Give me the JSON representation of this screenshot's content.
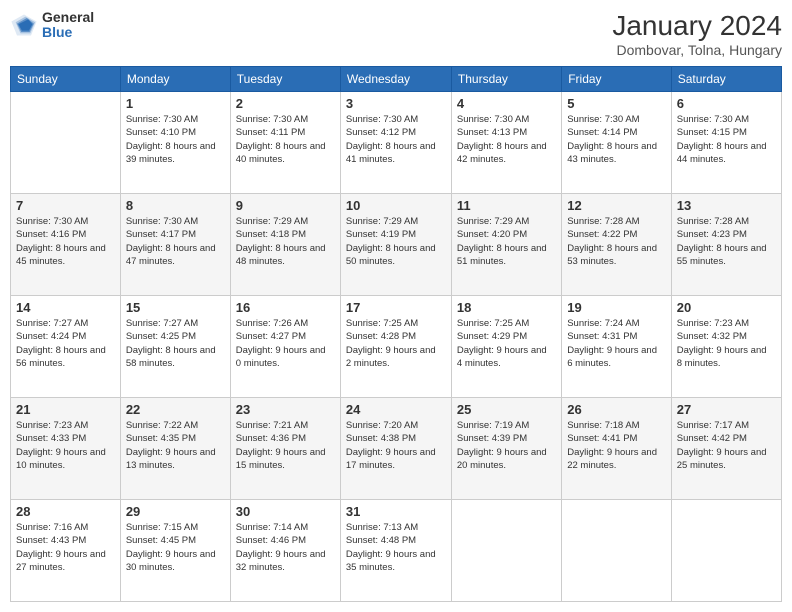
{
  "header": {
    "logo_general": "General",
    "logo_blue": "Blue",
    "month_title": "January 2024",
    "location": "Dombovar, Tolna, Hungary"
  },
  "weekdays": [
    "Sunday",
    "Monday",
    "Tuesday",
    "Wednesday",
    "Thursday",
    "Friday",
    "Saturday"
  ],
  "weeks": [
    [
      {
        "day": "",
        "sunrise": "",
        "sunset": "",
        "daylight": ""
      },
      {
        "day": "1",
        "sunrise": "Sunrise: 7:30 AM",
        "sunset": "Sunset: 4:10 PM",
        "daylight": "Daylight: 8 hours and 39 minutes."
      },
      {
        "day": "2",
        "sunrise": "Sunrise: 7:30 AM",
        "sunset": "Sunset: 4:11 PM",
        "daylight": "Daylight: 8 hours and 40 minutes."
      },
      {
        "day": "3",
        "sunrise": "Sunrise: 7:30 AM",
        "sunset": "Sunset: 4:12 PM",
        "daylight": "Daylight: 8 hours and 41 minutes."
      },
      {
        "day": "4",
        "sunrise": "Sunrise: 7:30 AM",
        "sunset": "Sunset: 4:13 PM",
        "daylight": "Daylight: 8 hours and 42 minutes."
      },
      {
        "day": "5",
        "sunrise": "Sunrise: 7:30 AM",
        "sunset": "Sunset: 4:14 PM",
        "daylight": "Daylight: 8 hours and 43 minutes."
      },
      {
        "day": "6",
        "sunrise": "Sunrise: 7:30 AM",
        "sunset": "Sunset: 4:15 PM",
        "daylight": "Daylight: 8 hours and 44 minutes."
      }
    ],
    [
      {
        "day": "7",
        "sunrise": "Sunrise: 7:30 AM",
        "sunset": "Sunset: 4:16 PM",
        "daylight": "Daylight: 8 hours and 45 minutes."
      },
      {
        "day": "8",
        "sunrise": "Sunrise: 7:30 AM",
        "sunset": "Sunset: 4:17 PM",
        "daylight": "Daylight: 8 hours and 47 minutes."
      },
      {
        "day": "9",
        "sunrise": "Sunrise: 7:29 AM",
        "sunset": "Sunset: 4:18 PM",
        "daylight": "Daylight: 8 hours and 48 minutes."
      },
      {
        "day": "10",
        "sunrise": "Sunrise: 7:29 AM",
        "sunset": "Sunset: 4:19 PM",
        "daylight": "Daylight: 8 hours and 50 minutes."
      },
      {
        "day": "11",
        "sunrise": "Sunrise: 7:29 AM",
        "sunset": "Sunset: 4:20 PM",
        "daylight": "Daylight: 8 hours and 51 minutes."
      },
      {
        "day": "12",
        "sunrise": "Sunrise: 7:28 AM",
        "sunset": "Sunset: 4:22 PM",
        "daylight": "Daylight: 8 hours and 53 minutes."
      },
      {
        "day": "13",
        "sunrise": "Sunrise: 7:28 AM",
        "sunset": "Sunset: 4:23 PM",
        "daylight": "Daylight: 8 hours and 55 minutes."
      }
    ],
    [
      {
        "day": "14",
        "sunrise": "Sunrise: 7:27 AM",
        "sunset": "Sunset: 4:24 PM",
        "daylight": "Daylight: 8 hours and 56 minutes."
      },
      {
        "day": "15",
        "sunrise": "Sunrise: 7:27 AM",
        "sunset": "Sunset: 4:25 PM",
        "daylight": "Daylight: 8 hours and 58 minutes."
      },
      {
        "day": "16",
        "sunrise": "Sunrise: 7:26 AM",
        "sunset": "Sunset: 4:27 PM",
        "daylight": "Daylight: 9 hours and 0 minutes."
      },
      {
        "day": "17",
        "sunrise": "Sunrise: 7:25 AM",
        "sunset": "Sunset: 4:28 PM",
        "daylight": "Daylight: 9 hours and 2 minutes."
      },
      {
        "day": "18",
        "sunrise": "Sunrise: 7:25 AM",
        "sunset": "Sunset: 4:29 PM",
        "daylight": "Daylight: 9 hours and 4 minutes."
      },
      {
        "day": "19",
        "sunrise": "Sunrise: 7:24 AM",
        "sunset": "Sunset: 4:31 PM",
        "daylight": "Daylight: 9 hours and 6 minutes."
      },
      {
        "day": "20",
        "sunrise": "Sunrise: 7:23 AM",
        "sunset": "Sunset: 4:32 PM",
        "daylight": "Daylight: 9 hours and 8 minutes."
      }
    ],
    [
      {
        "day": "21",
        "sunrise": "Sunrise: 7:23 AM",
        "sunset": "Sunset: 4:33 PM",
        "daylight": "Daylight: 9 hours and 10 minutes."
      },
      {
        "day": "22",
        "sunrise": "Sunrise: 7:22 AM",
        "sunset": "Sunset: 4:35 PM",
        "daylight": "Daylight: 9 hours and 13 minutes."
      },
      {
        "day": "23",
        "sunrise": "Sunrise: 7:21 AM",
        "sunset": "Sunset: 4:36 PM",
        "daylight": "Daylight: 9 hours and 15 minutes."
      },
      {
        "day": "24",
        "sunrise": "Sunrise: 7:20 AM",
        "sunset": "Sunset: 4:38 PM",
        "daylight": "Daylight: 9 hours and 17 minutes."
      },
      {
        "day": "25",
        "sunrise": "Sunrise: 7:19 AM",
        "sunset": "Sunset: 4:39 PM",
        "daylight": "Daylight: 9 hours and 20 minutes."
      },
      {
        "day": "26",
        "sunrise": "Sunrise: 7:18 AM",
        "sunset": "Sunset: 4:41 PM",
        "daylight": "Daylight: 9 hours and 22 minutes."
      },
      {
        "day": "27",
        "sunrise": "Sunrise: 7:17 AM",
        "sunset": "Sunset: 4:42 PM",
        "daylight": "Daylight: 9 hours and 25 minutes."
      }
    ],
    [
      {
        "day": "28",
        "sunrise": "Sunrise: 7:16 AM",
        "sunset": "Sunset: 4:43 PM",
        "daylight": "Daylight: 9 hours and 27 minutes."
      },
      {
        "day": "29",
        "sunrise": "Sunrise: 7:15 AM",
        "sunset": "Sunset: 4:45 PM",
        "daylight": "Daylight: 9 hours and 30 minutes."
      },
      {
        "day": "30",
        "sunrise": "Sunrise: 7:14 AM",
        "sunset": "Sunset: 4:46 PM",
        "daylight": "Daylight: 9 hours and 32 minutes."
      },
      {
        "day": "31",
        "sunrise": "Sunrise: 7:13 AM",
        "sunset": "Sunset: 4:48 PM",
        "daylight": "Daylight: 9 hours and 35 minutes."
      },
      {
        "day": "",
        "sunrise": "",
        "sunset": "",
        "daylight": ""
      },
      {
        "day": "",
        "sunrise": "",
        "sunset": "",
        "daylight": ""
      },
      {
        "day": "",
        "sunrise": "",
        "sunset": "",
        "daylight": ""
      }
    ]
  ]
}
